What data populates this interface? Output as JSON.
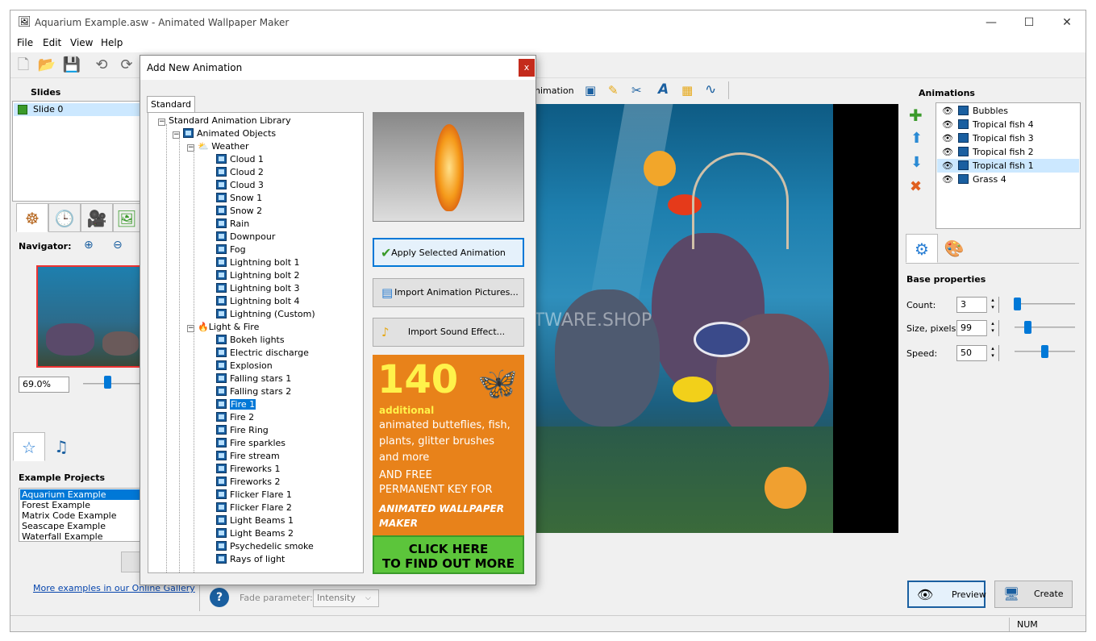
{
  "window": {
    "title": "Aquarium Example.asw - Animated Wallpaper Maker",
    "minimize": "—",
    "maximize": "☐",
    "close": "✕"
  },
  "menu": [
    "File",
    "Edit",
    "View",
    "Help"
  ],
  "slides": {
    "header": "Slides",
    "items": [
      "Slide 0"
    ]
  },
  "navigator": {
    "label": "Navigator:",
    "zoom": "69.0%"
  },
  "examples": {
    "header": "Example Projects",
    "items": [
      "Aquarium Example",
      "Forest Example",
      "Matrix Code Example",
      "Seascape Example",
      "Waterfall Example"
    ],
    "link": "More examples in our Online Gallery"
  },
  "fade": {
    "label": "Fade parameter:",
    "value": "Intensity"
  },
  "canvas_toolbar": {
    "animation_label": "nimation"
  },
  "dialog": {
    "title": "Add New Animation",
    "close": "x",
    "tab": "Standard",
    "tree": {
      "root": "Standard Animation Library",
      "animated_objects": "Animated Objects",
      "weather": "Weather",
      "weather_items": [
        "Cloud 1",
        "Cloud 2",
        "Cloud 3",
        "Snow 1",
        "Snow 2",
        "Rain",
        "Downpour",
        "Fog",
        "Lightning bolt 1",
        "Lightning bolt 2",
        "Lightning bolt 3",
        "Lightning bolt 4",
        "Lightning (Custom)"
      ],
      "light_fire": "Light & Fire",
      "light_items": [
        "Bokeh lights",
        "Electric discharge",
        "Explosion",
        "Falling stars 1",
        "Falling stars 2",
        "Fire 1",
        "Fire 2",
        "Fire Ring",
        "Fire sparkles",
        "Fire stream",
        "Fireworks 1",
        "Fireworks 2",
        "Flicker Flare 1",
        "Flicker Flare 2",
        "Light Beams 1",
        "Light Beams 2",
        "Psychedelic smoke",
        "Rays of light"
      ],
      "selected": "Fire 1"
    },
    "buttons": {
      "apply": "Apply Selected Animation",
      "import_pictures": "Import Animation Pictures...",
      "import_sound": "Import Sound Effect..."
    },
    "ad": {
      "number": "140",
      "additional": "additional",
      "line1": "animated butteflies, fish,",
      "line2": "plants, glitter brushes",
      "line3": "and more",
      "line4": "AND FREE",
      "line5": "PERMANENT KEY FOR",
      "line6": "ANIMATED WALLPAPER",
      "line7": "MAKER",
      "cta1": "CLICK HERE",
      "cta2": "TO FIND OUT MORE"
    }
  },
  "watermark": "© Captured by THESOFTWARE.SHOP",
  "animations": {
    "header": "Animations",
    "items": [
      "Bubbles",
      "Tropical fish 4",
      "Tropical fish 3",
      "Tropical fish 2",
      "Tropical fish 1",
      "Grass 4"
    ],
    "selected": "Tropical fish 1"
  },
  "base_props": {
    "header": "Base properties",
    "count_label": "Count:",
    "count": "3",
    "size_label": "Size, pixels:",
    "size": "99",
    "speed_label": "Speed:",
    "speed": "50"
  },
  "buttons": {
    "preview": "Preview",
    "create": "Create"
  },
  "status": {
    "num": "NUM"
  }
}
